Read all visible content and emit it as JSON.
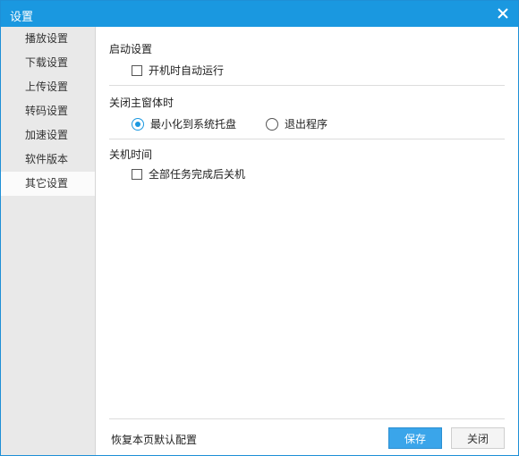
{
  "window": {
    "title": "设置"
  },
  "sidebar": {
    "items": [
      {
        "label": "播放设置"
      },
      {
        "label": "下载设置"
      },
      {
        "label": "上传设置"
      },
      {
        "label": "转码设置"
      },
      {
        "label": "加速设置"
      },
      {
        "label": "软件版本"
      },
      {
        "label": "其它设置",
        "active": true
      }
    ]
  },
  "startup": {
    "title": "启动设置",
    "autostart_label": "开机时自动运行",
    "autostart_checked": false
  },
  "close_main": {
    "title": "关闭主窗体时",
    "minimize_label": "最小化到系统托盘",
    "exit_label": "退出程序",
    "selected": "minimize"
  },
  "shutdown": {
    "title": "关机时间",
    "after_tasks_label": "全部任务完成后关机",
    "after_tasks_checked": false
  },
  "footer": {
    "restore_label": "恢复本页默认配置",
    "save_label": "保存",
    "close_label": "关闭"
  },
  "colors": {
    "accent": "#1a98e0",
    "sidebar_bg": "#e9e9e9"
  }
}
